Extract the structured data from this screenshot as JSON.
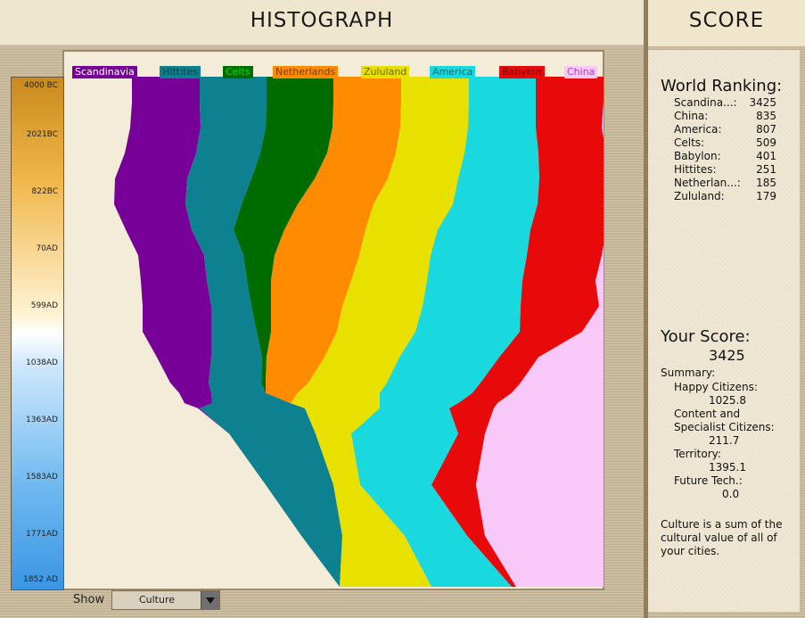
{
  "header": {
    "title": "HISTOGRAPH",
    "score_title": "SCORE"
  },
  "timeline": [
    "4000 BC",
    "2021BC",
    "822BC",
    "70AD",
    "599AD",
    "1038AD",
    "1363AD",
    "1583AD",
    "1771AD",
    "1852 AD"
  ],
  "civs": [
    {
      "name": "Scandinavia",
      "color": "#770098"
    },
    {
      "name": "Hittites",
      "color": "#0d8190"
    },
    {
      "name": "Celts",
      "color": "#006c00"
    },
    {
      "name": "Netherlands",
      "color": "#ff8c00"
    },
    {
      "name": "Zululand",
      "color": "#e8e100"
    },
    {
      "name": "America",
      "color": "#1ad9de"
    },
    {
      "name": "Babylon",
      "color": "#e80a0a"
    },
    {
      "name": "China",
      "color": "#f8c8f8"
    }
  ],
  "chart_data": {
    "type": "area",
    "series_order": [
      "Scandinavia",
      "Hittites",
      "Celts",
      "Netherlands",
      "Zululand",
      "America",
      "Babylon",
      "China"
    ],
    "colors": [
      "#770098",
      "#0d8190",
      "#006c00",
      "#ff8c00",
      "#e8e100",
      "#1ad9de",
      "#e80a0a",
      "#f8c8f8"
    ],
    "boundaries": [
      [
        [
          0,
          74
        ],
        [
          0.05,
          74
        ],
        [
          0.1,
          72
        ],
        [
          0.15,
          66
        ],
        [
          0.2,
          55
        ],
        [
          0.25,
          54
        ],
        [
          0.3,
          67
        ],
        [
          0.35,
          81
        ],
        [
          0.4,
          84
        ],
        [
          0.45,
          86
        ],
        [
          0.5,
          86
        ],
        [
          0.55,
          102
        ],
        [
          0.6,
          117
        ],
        [
          0.62,
          127
        ],
        [
          0.64,
          133
        ],
        [
          0.65,
          148
        ],
        [
          0.7,
          183
        ],
        [
          0.8,
          224
        ],
        [
          0.9,
          264
        ],
        [
          1.0,
          307
        ]
      ],
      [
        [
          0,
          150
        ],
        [
          0.05,
          150
        ],
        [
          0.1,
          151
        ],
        [
          0.15,
          146
        ],
        [
          0.2,
          136
        ],
        [
          0.25,
          134
        ],
        [
          0.3,
          141
        ],
        [
          0.35,
          155
        ],
        [
          0.4,
          158
        ],
        [
          0.45,
          163
        ],
        [
          0.5,
          163
        ],
        [
          0.55,
          163
        ],
        [
          0.6,
          160
        ],
        [
          0.62,
          163
        ],
        [
          0.64,
          164
        ],
        [
          0.65,
          150
        ],
        [
          0.7,
          183
        ],
        [
          0.8,
          224
        ],
        [
          0.9,
          264
        ],
        [
          1.0,
          307
        ]
      ],
      [
        [
          0,
          225
        ],
        [
          0.05,
          225
        ],
        [
          0.1,
          224
        ],
        [
          0.15,
          218
        ],
        [
          0.2,
          208
        ],
        [
          0.25,
          197
        ],
        [
          0.3,
          188
        ],
        [
          0.35,
          199
        ],
        [
          0.4,
          203
        ],
        [
          0.45,
          208
        ],
        [
          0.5,
          214
        ],
        [
          0.55,
          220
        ],
        [
          0.6,
          219
        ],
        [
          0.62,
          224
        ],
        [
          0.64,
          252
        ],
        [
          0.65,
          268
        ],
        [
          0.7,
          280
        ],
        [
          0.8,
          300
        ],
        [
          0.9,
          310
        ],
        [
          1.0,
          307
        ]
      ],
      [
        [
          0,
          300
        ],
        [
          0.05,
          300
        ],
        [
          0.1,
          299
        ],
        [
          0.15,
          293
        ],
        [
          0.2,
          279
        ],
        [
          0.25,
          260
        ],
        [
          0.3,
          245
        ],
        [
          0.35,
          234
        ],
        [
          0.4,
          230
        ],
        [
          0.45,
          230
        ],
        [
          0.5,
          230
        ],
        [
          0.55,
          225
        ],
        [
          0.6,
          224
        ],
        [
          0.62,
          224
        ],
        [
          0.64,
          252
        ],
        [
          0.65,
          268
        ],
        [
          0.7,
          280
        ],
        [
          0.8,
          300
        ],
        [
          0.9,
          310
        ],
        [
          1.0,
          307
        ]
      ],
      [
        [
          0,
          376
        ],
        [
          0.05,
          376
        ],
        [
          0.1,
          375
        ],
        [
          0.15,
          370
        ],
        [
          0.2,
          361
        ],
        [
          0.25,
          345
        ],
        [
          0.3,
          336
        ],
        [
          0.35,
          329
        ],
        [
          0.4,
          320
        ],
        [
          0.45,
          310
        ],
        [
          0.5,
          304
        ],
        [
          0.55,
          290
        ],
        [
          0.6,
          272
        ],
        [
          0.62,
          260
        ],
        [
          0.64,
          252
        ],
        [
          0.65,
          268
        ],
        [
          0.7,
          280
        ],
        [
          0.8,
          300
        ],
        [
          0.9,
          310
        ],
        [
          1.0,
          307
        ]
      ],
      [
        [
          0,
          452
        ],
        [
          0.05,
          452
        ],
        [
          0.1,
          451
        ],
        [
          0.15,
          447
        ],
        [
          0.2,
          440
        ],
        [
          0.25,
          434
        ],
        [
          0.3,
          417
        ],
        [
          0.35,
          409
        ],
        [
          0.4,
          405
        ],
        [
          0.45,
          400
        ],
        [
          0.5,
          392
        ],
        [
          0.55,
          374
        ],
        [
          0.6,
          360
        ],
        [
          0.62,
          352
        ],
        [
          0.64,
          352
        ],
        [
          0.65,
          352
        ],
        [
          0.7,
          320
        ],
        [
          0.8,
          330
        ],
        [
          0.9,
          380
        ],
        [
          1.0,
          410
        ]
      ],
      [
        [
          0,
          527
        ],
        [
          0.05,
          527
        ],
        [
          0.1,
          527
        ],
        [
          0.15,
          530
        ],
        [
          0.2,
          531
        ],
        [
          0.25,
          529
        ],
        [
          0.3,
          521
        ],
        [
          0.35,
          517
        ],
        [
          0.4,
          512
        ],
        [
          0.45,
          510
        ],
        [
          0.5,
          509
        ],
        [
          0.55,
          486
        ],
        [
          0.6,
          465
        ],
        [
          0.62,
          456
        ],
        [
          0.64,
          440
        ],
        [
          0.65,
          430
        ],
        [
          0.7,
          440
        ],
        [
          0.8,
          410
        ],
        [
          0.9,
          450
        ],
        [
          1.0,
          500
        ]
      ],
      [
        [
          0,
          603
        ],
        [
          0.05,
          603
        ],
        [
          0.1,
          601
        ],
        [
          0.15,
          606
        ],
        [
          0.2,
          606
        ],
        [
          0.25,
          606
        ],
        [
          0.3,
          606
        ],
        [
          0.35,
          601
        ],
        [
          0.4,
          594
        ],
        [
          0.45,
          598
        ],
        [
          0.5,
          579
        ],
        [
          0.55,
          530
        ],
        [
          0.6,
          510
        ],
        [
          0.62,
          500
        ],
        [
          0.64,
          484
        ],
        [
          0.65,
          480
        ],
        [
          0.7,
          470
        ],
        [
          0.8,
          460
        ],
        [
          0.9,
          470
        ],
        [
          1.0,
          505
        ]
      ]
    ],
    "right_edge": 603
  },
  "world_ranking": {
    "title": "World Ranking:",
    "rows": [
      {
        "name": "Scandina...:",
        "value": "3425"
      },
      {
        "name": "China:",
        "value": "835"
      },
      {
        "name": "America:",
        "value": "807"
      },
      {
        "name": "Celts:",
        "value": "509"
      },
      {
        "name": "Babylon:",
        "value": "401"
      },
      {
        "name": "Hittites:",
        "value": "251"
      },
      {
        "name": "Netherlan...:",
        "value": "185"
      },
      {
        "name": "Zululand:",
        "value": "179"
      }
    ]
  },
  "your_score": {
    "title": "Your Score:",
    "value": "3425",
    "summary_label": "Summary:",
    "happy_label": "Happy Citizens:",
    "happy_value": "1025.8",
    "content_label_1": "Content and",
    "content_label_2": "Specialist Citizens:",
    "content_value": "211.7",
    "territory_label": "Territory:",
    "territory_value": "1395.1",
    "future_label": "Future Tech.:",
    "future_value": "0.0",
    "note_1": "Culture is a sum of the",
    "note_2": "cultural value of all of",
    "note_3": "your cities."
  },
  "show": {
    "label": "Show",
    "selected": "Culture"
  }
}
